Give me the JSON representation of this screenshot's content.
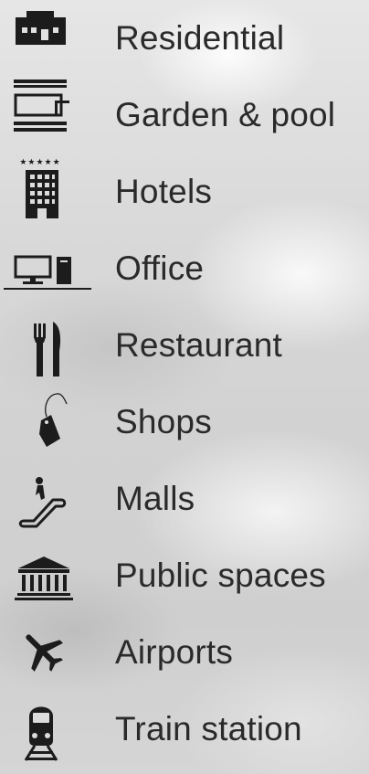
{
  "categories": [
    {
      "label": "Residential",
      "icon": "building-icon"
    },
    {
      "label": "Garden & pool",
      "icon": "garden-pool-icon"
    },
    {
      "label": "Hotels",
      "icon": "hotel-icon"
    },
    {
      "label": "Office",
      "icon": "office-computer-icon"
    },
    {
      "label": "Restaurant",
      "icon": "fork-knife-icon"
    },
    {
      "label": "Shops",
      "icon": "price-tag-icon"
    },
    {
      "label": "Malls",
      "icon": "escalator-icon"
    },
    {
      "label": "Public spaces",
      "icon": "public-building-icon"
    },
    {
      "label": "Airports",
      "icon": "airplane-icon"
    },
    {
      "label": "Train station",
      "icon": "train-icon"
    }
  ],
  "hotel_stars": "★★★★★",
  "colors": {
    "icon": "#1c1c1c",
    "text": "#2a2a2a"
  }
}
